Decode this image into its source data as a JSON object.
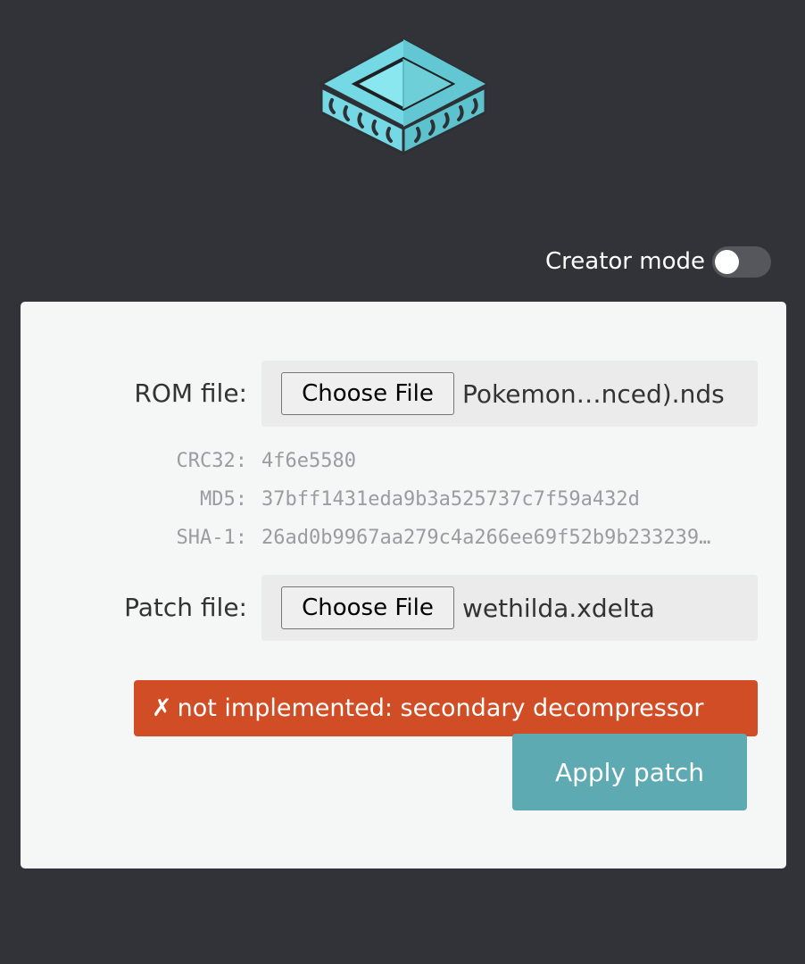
{
  "header": {
    "logo_icon": "chip-logo-icon",
    "accent_color": "#74d9e4"
  },
  "creator_mode": {
    "label": "Creator mode",
    "enabled": false
  },
  "rom": {
    "label": "ROM file:",
    "button_label": "Choose File",
    "file_name": "Pokemon…nced).nds"
  },
  "hashes": [
    {
      "label": "CRC32:",
      "value": "4f6e5580"
    },
    {
      "label": "MD5:",
      "value": "37bff1431eda9b3a525737c7f59a432d"
    },
    {
      "label": "SHA-1:",
      "value": "26ad0b9967aa279c4a266ee69f52b9b233239…"
    }
  ],
  "patch": {
    "label": "Patch file:",
    "button_label": "Choose File",
    "file_name": "wethilda.xdelta"
  },
  "error": {
    "icon": "✗",
    "message": "not implemented: secondary decompressor",
    "color": "#d04d26"
  },
  "apply": {
    "label": "Apply patch",
    "color": "#5eaab3"
  }
}
